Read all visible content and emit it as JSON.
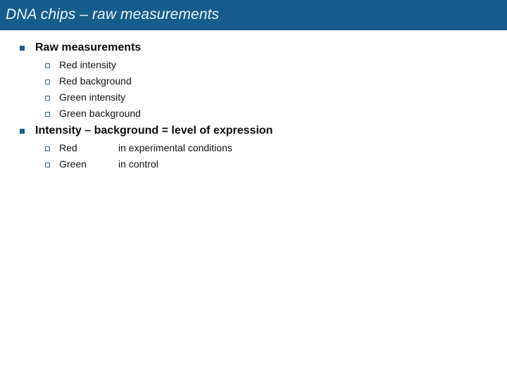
{
  "slide": {
    "title": "DNA chips – raw measurements",
    "banner_color": "#175D8C",
    "title_color": "#E8F4FB",
    "bullet_color": "#1F5C86",
    "background_color": "#FFFFFF",
    "blocks": [
      {
        "heading": "Raw measurements",
        "bullet_icon": "filled-square-bullet",
        "items": [
          {
            "label": "Red intensity",
            "detail": "",
            "bullet_icon": "hollow-square-bullet"
          },
          {
            "label": "Red background",
            "detail": "",
            "bullet_icon": "hollow-square-bullet"
          },
          {
            "label": "Green intensity",
            "detail": "",
            "bullet_icon": "hollow-square-bullet"
          },
          {
            "label": "Green background",
            "detail": "",
            "bullet_icon": "hollow-square-bullet"
          }
        ]
      },
      {
        "heading": "Intensity – background = level of expression",
        "bullet_icon": "filled-square-bullet",
        "items": [
          {
            "label": "Red",
            "detail": "in experimental conditions",
            "bullet_icon": "hollow-square-bullet"
          },
          {
            "label": "Green",
            "detail": "in control",
            "bullet_icon": "hollow-square-bullet"
          }
        ]
      }
    ]
  }
}
